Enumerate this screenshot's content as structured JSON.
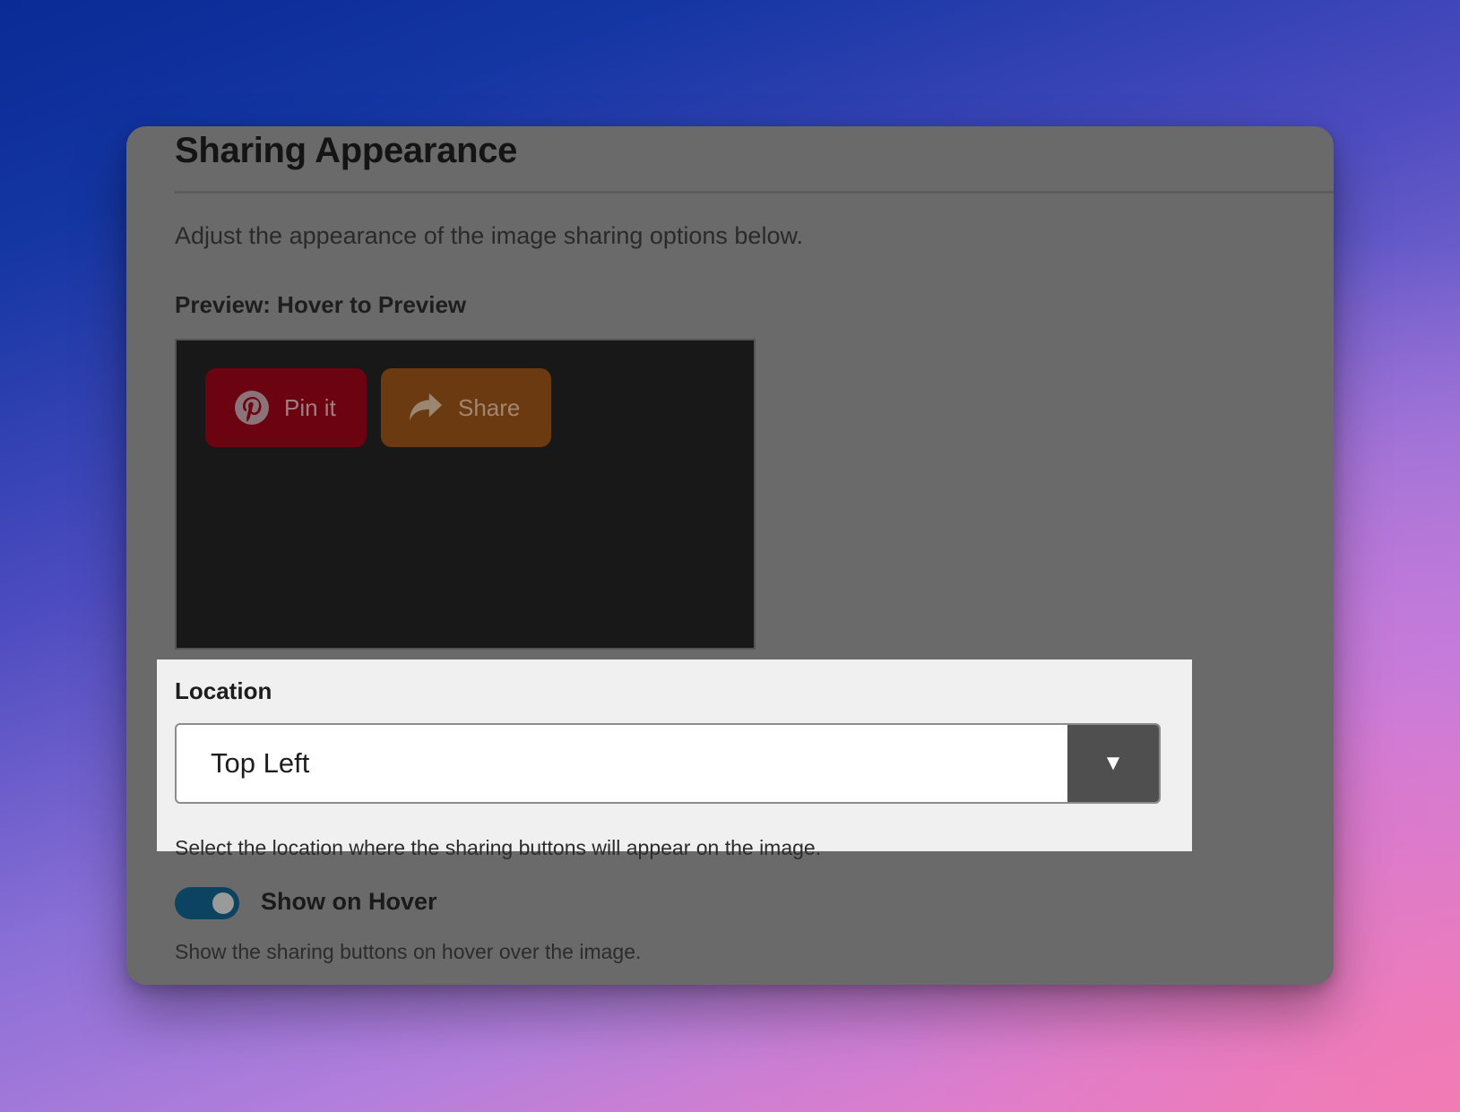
{
  "dialog": {
    "title": "Sharing Appearance",
    "intro": "Adjust the appearance of the image sharing options below."
  },
  "preview": {
    "label": "Preview: Hover to Preview",
    "buttons": [
      {
        "label": "Pin it",
        "icon": "pinterest-icon",
        "color": "#6b0410"
      },
      {
        "label": "Share",
        "icon": "share-arrow-icon",
        "color": "#6c3a10"
      }
    ]
  },
  "location": {
    "label": "Location",
    "selected": "Top Left",
    "arrow": "▼",
    "help": "Select the location where the sharing buttons will appear on the image."
  },
  "show_on_hover": {
    "label": "Show on Hover",
    "enabled": true,
    "help": "Show the sharing buttons on hover over the image."
  },
  "colors": {
    "toggle_on": "#0b4361",
    "highlight_panel": "#f0f0f0",
    "overlay": "#6a6a6a"
  }
}
